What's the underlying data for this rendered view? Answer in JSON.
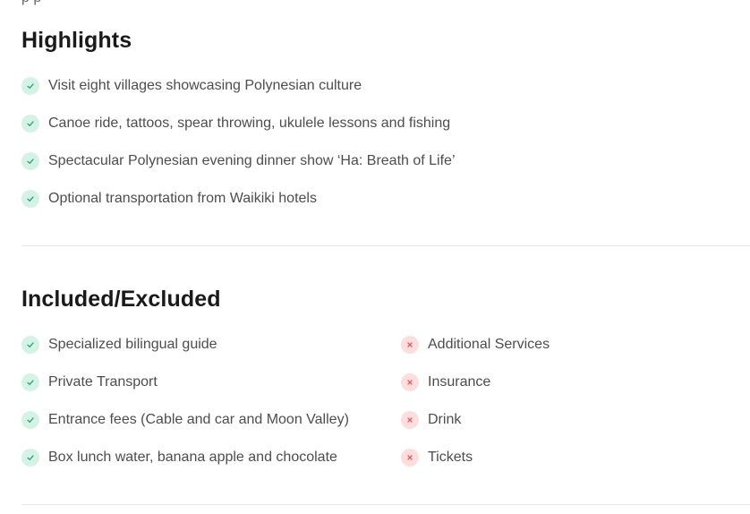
{
  "highlights": {
    "title": "Highlights",
    "items": [
      "Visit eight villages showcasing Polynesian culture",
      "Canoe ride, tattoos, spear throwing, ukulele lessons and fishing",
      "Spectacular Polynesian evening dinner show ‘Ha: Breath of Life’",
      "Optional transportation from Waikiki hotels"
    ]
  },
  "included_excluded": {
    "title": "Included/Excluded",
    "included": [
      "Specialized bilingual guide",
      "Private Transport",
      "Entrance fees (Cable and car and Moon Valley)",
      "Box lunch water, banana apple and chocolate"
    ],
    "excluded": [
      "Additional Services",
      "Insurance",
      "Drink",
      "Tickets"
    ]
  },
  "icons": {
    "included": "check-icon",
    "excluded": "close-icon"
  },
  "colors": {
    "check_bg": "#d4f3e6",
    "check_fg": "#2a9d6e",
    "cross_bg": "#fcdede",
    "cross_fg": "#e05b5b"
  }
}
